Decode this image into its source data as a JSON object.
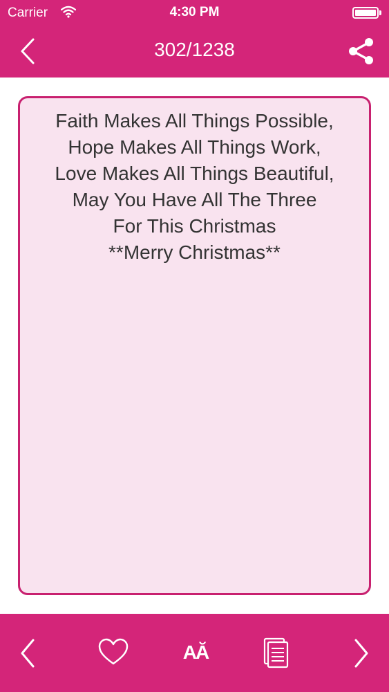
{
  "status_bar": {
    "carrier": "Carrier",
    "time": "4:30 PM"
  },
  "nav": {
    "title": "302/1238",
    "back_icon": "chevron-left-icon",
    "share_icon": "share-icon"
  },
  "message": {
    "lines": [
      "Faith Makes All Things Possible,",
      "Hope Makes All Things Work,",
      "Love Makes All Things Beautiful,",
      "May You Have All The Three",
      "For This Christmas",
      "**Merry Christmas**"
    ]
  },
  "toolbar": {
    "prev_icon": "chevron-left-icon",
    "favorite_icon": "heart-icon",
    "font_label": "AĂ",
    "copy_icon": "copy-icon",
    "next_icon": "chevron-right-icon"
  },
  "colors": {
    "accent": "#d42579",
    "card_background": "#f9e3ef",
    "card_border": "#c8206f",
    "text": "#333333"
  }
}
